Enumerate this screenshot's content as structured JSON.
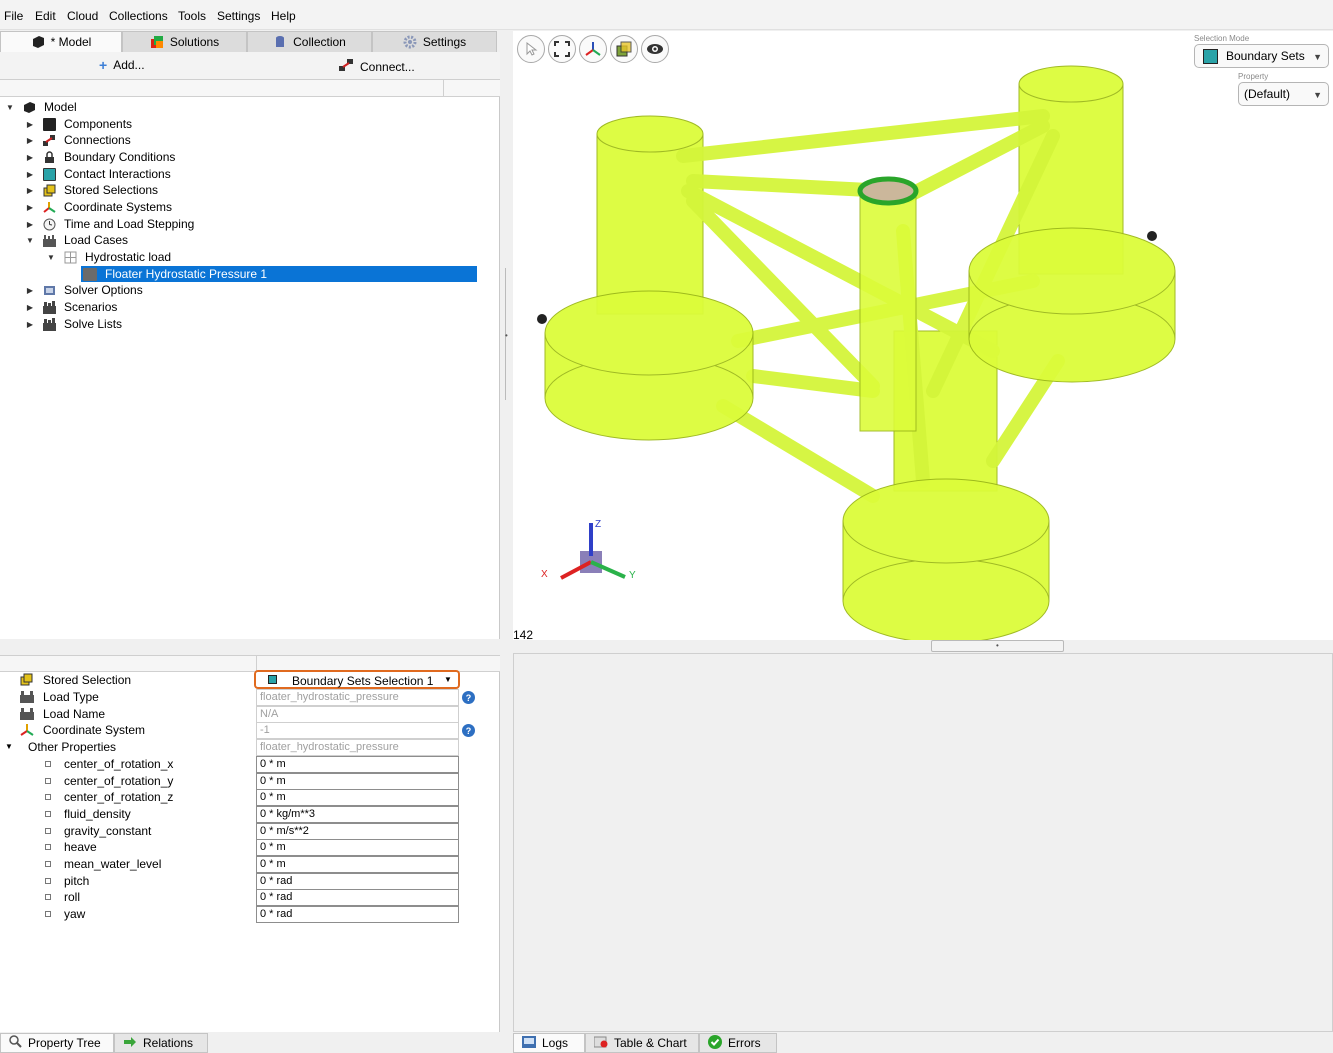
{
  "menu": [
    "File",
    "Edit",
    "Cloud",
    "Collections",
    "Tools",
    "Settings",
    "Help"
  ],
  "left_tabs": [
    {
      "label": "* Model",
      "icon": "model-icon"
    },
    {
      "label": "Solutions",
      "icon": "solutions-icon"
    },
    {
      "label": "Collection",
      "icon": "collection-icon"
    },
    {
      "label": "Settings",
      "icon": "gear-icon"
    }
  ],
  "toolbar": {
    "add_label": "Add...",
    "connect_label": "Connect..."
  },
  "tree": {
    "root": "Model",
    "items": [
      {
        "label": "Components",
        "icon": "components-icon"
      },
      {
        "label": "Connections",
        "icon": "connections-icon"
      },
      {
        "label": "Boundary Conditions",
        "icon": "lock-icon"
      },
      {
        "label": "Contact Interactions",
        "icon": "contact-icon"
      },
      {
        "label": "Stored Selections",
        "icon": "stored-selections-icon"
      },
      {
        "label": "Coordinate Systems",
        "icon": "axes-icon"
      },
      {
        "label": "Time and Load Stepping",
        "icon": "clock-icon"
      },
      {
        "label": "Load Cases",
        "icon": "load-cases-icon"
      },
      {
        "label": "Hydrostatic load",
        "icon": "grid-icon"
      },
      {
        "label": "Floater Hydrostatic Pressure 1",
        "icon": "pressure-icon"
      },
      {
        "label": "Solver Options",
        "icon": "solver-icon"
      },
      {
        "label": "Scenarios",
        "icon": "scenarios-icon"
      },
      {
        "label": "Solve Lists",
        "icon": "solve-lists-icon"
      }
    ]
  },
  "viewport": {
    "selection_mode_label": "Selection Mode",
    "selection_mode_value": "Boundary Sets",
    "property_label": "Property",
    "property_value": "(Default)",
    "count": "142",
    "axes": {
      "x": "X",
      "y": "Y",
      "z": "Z"
    }
  },
  "properties": {
    "stored_selection_label": "Stored Selection",
    "stored_selection_value": "Boundary Sets Selection 1",
    "load_type_label": "Load Type",
    "load_type_value": "floater_hydrostatic_pressure",
    "load_name_label": "Load Name",
    "load_name_value": "N/A",
    "coord_system_label": "Coordinate System",
    "coord_system_value": "-1",
    "other_label": "Other Properties",
    "other_value": "floater_hydrostatic_pressure",
    "rows": [
      {
        "label": "center_of_rotation_x",
        "value": "0 * m"
      },
      {
        "label": "center_of_rotation_y",
        "value": "0 * m"
      },
      {
        "label": "center_of_rotation_z",
        "value": "0 * m"
      },
      {
        "label": "fluid_density",
        "value": "0 * kg/m**3"
      },
      {
        "label": "gravity_constant",
        "value": "0 * m/s**2"
      },
      {
        "label": "heave",
        "value": "0 * m"
      },
      {
        "label": "mean_water_level",
        "value": "0 * m"
      },
      {
        "label": "pitch",
        "value": "0 * rad"
      },
      {
        "label": "roll",
        "value": "0 * rad"
      },
      {
        "label": "yaw",
        "value": "0 * rad"
      }
    ]
  },
  "bottom_left_tabs": [
    "Property Tree",
    "Relations"
  ],
  "bottom_right_tabs": [
    "Logs",
    "Table & Chart",
    "Errors"
  ],
  "colors": {
    "selection": "#0a74d6",
    "model_fill": "#dcfc3a",
    "highlight_border": "#e06a1f"
  }
}
